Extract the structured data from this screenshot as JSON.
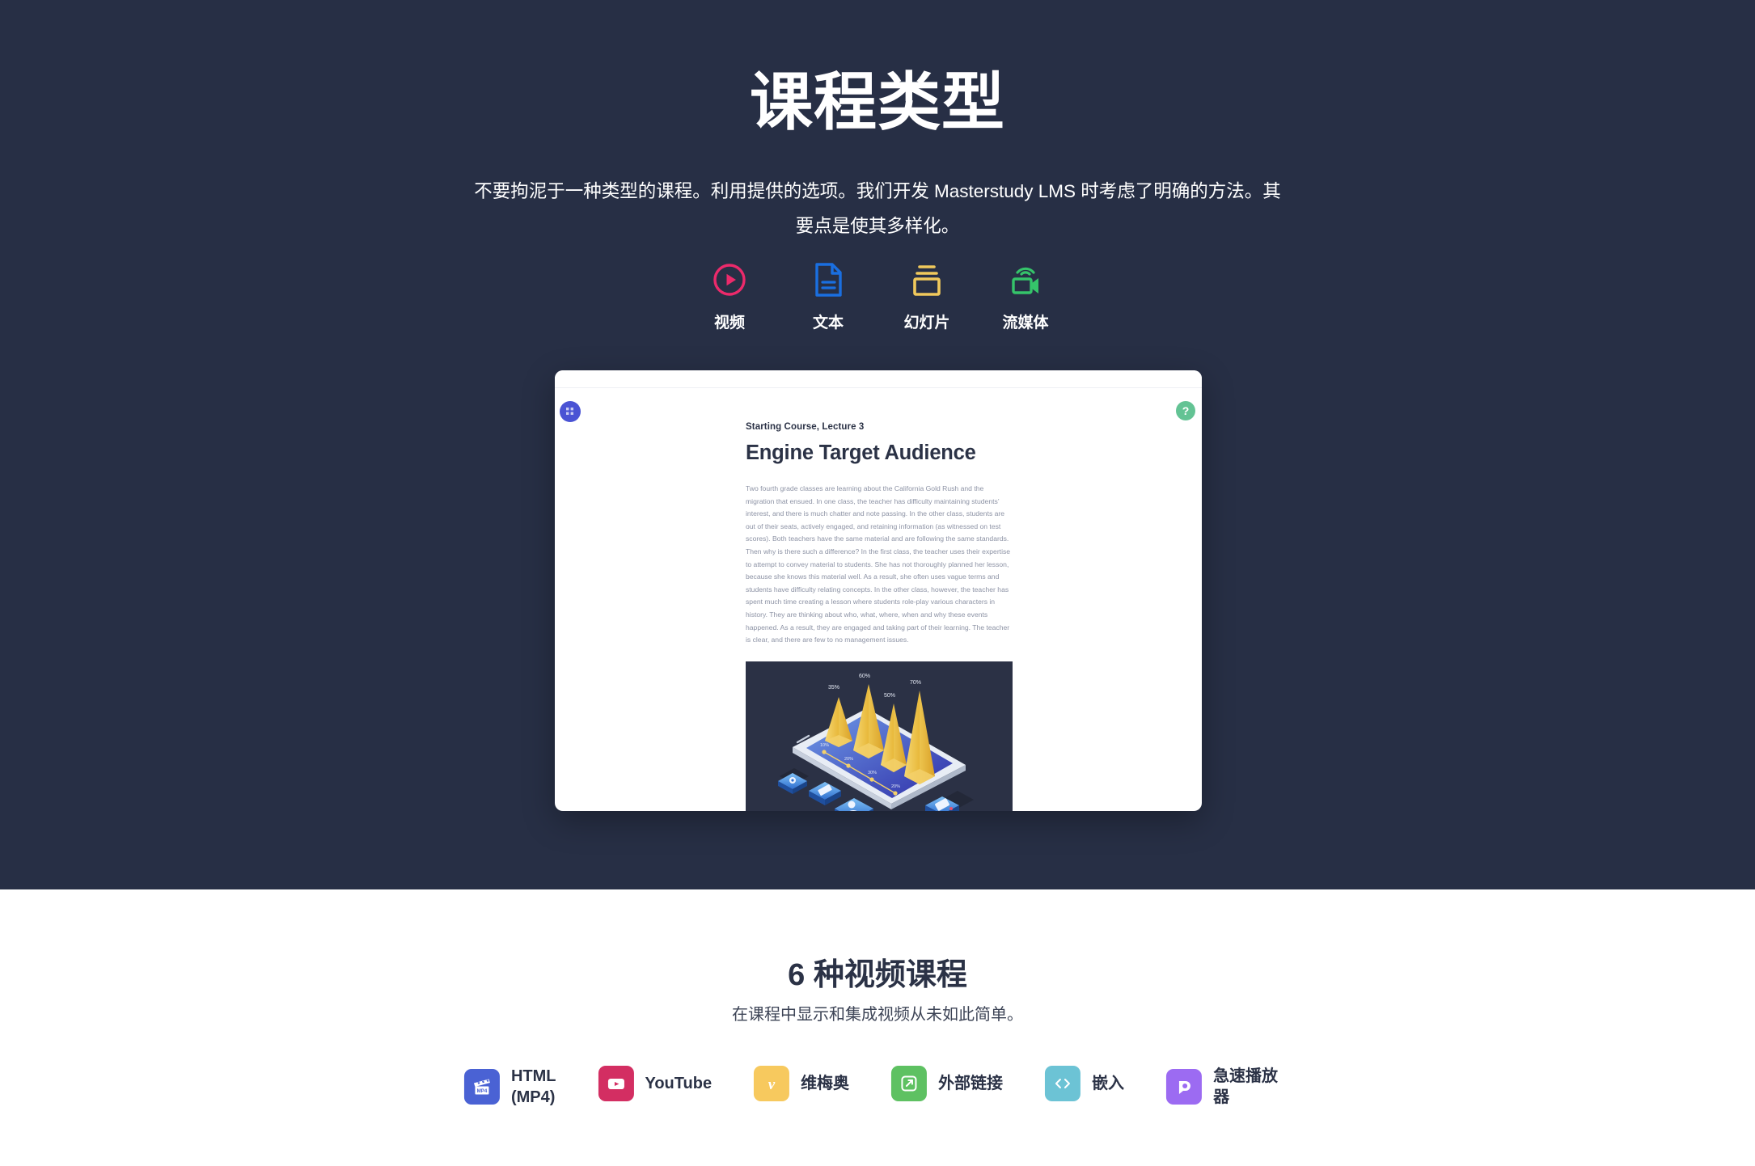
{
  "hero": {
    "title": "课程类型",
    "subtitle": "不要拘泥于一种类型的课程。利用提供的选项。我们开发 Masterstudy LMS 时考虑了明确的方法。其要点是使其多样化。",
    "bg_color": "#272f45",
    "course_types": [
      {
        "label": "视频",
        "icon": "play-circle-icon",
        "color": "#ec2a6b"
      },
      {
        "label": "文本",
        "icon": "document-icon",
        "color": "#1a6fe0"
      },
      {
        "label": "幻灯片",
        "icon": "slides-icon",
        "color": "#f0c95c"
      },
      {
        "label": "流媒体",
        "icon": "streaming-camera-icon",
        "color": "#35c46a"
      }
    ]
  },
  "preview": {
    "menu_icon": "grid-menu-icon",
    "help_label": "?",
    "kicker": "Starting Course, Lecture 3",
    "title": "Engine Target Audience",
    "body": "Two fourth grade classes are learning about the California Gold Rush and the migration that ensued. In one class, the teacher has difficulty maintaining students’ interest, and there is much chatter and note passing. In the other class, students are out of their seats, actively engaged, and retaining information (as witnessed on test scores). Both teachers have the same material and are following the same standards. Then why is there such a difference? In the first class, the teacher uses their expertise to attempt to convey material to students. She has not thoroughly planned her lesson, because she knows this material well. As a result, she often uses vague terms and students have difficulty relating concepts. In the other class, however, the teacher has spent much time creating a lesson where students role-play various characters in history. They are thinking about who, what, where, when and why these events happened. As a result, they are engaged and taking part of their learning. The teacher is clear, and there are few to no management issues.",
    "figure": {
      "alt": "isometric-phone-chart-illustration",
      "cone_labels": [
        "35%",
        "60%",
        "50%",
        "70%"
      ],
      "timeline_labels": [
        "10%",
        "20%",
        "30%",
        "20%"
      ],
      "bg_color": "#2b3145"
    }
  },
  "features": {
    "title": "6 种视频课程",
    "subtitle": "在课程中显示和集成视频从未如此简单。",
    "sources": [
      {
        "label": "HTML\n(MP4)",
        "icon": "mp4-clapperboard-icon",
        "color": "#4a62d4",
        "wide": false
      },
      {
        "label": "YouTube",
        "icon": "youtube-icon",
        "color": "#d32e62",
        "wide": true
      },
      {
        "label": "维梅奥",
        "icon": "vimeo-icon",
        "color": "#f7c95e",
        "wide": false
      },
      {
        "label": "外部链接",
        "icon": "external-link-icon",
        "color": "#5ec162",
        "wide": true
      },
      {
        "label": "嵌入",
        "icon": "embed-code-icon",
        "color": "#6cc3d5",
        "wide": false
      },
      {
        "label": "急速播放器",
        "icon": "presto-player-icon",
        "color": "#9c6bf2",
        "wide": false
      }
    ]
  }
}
